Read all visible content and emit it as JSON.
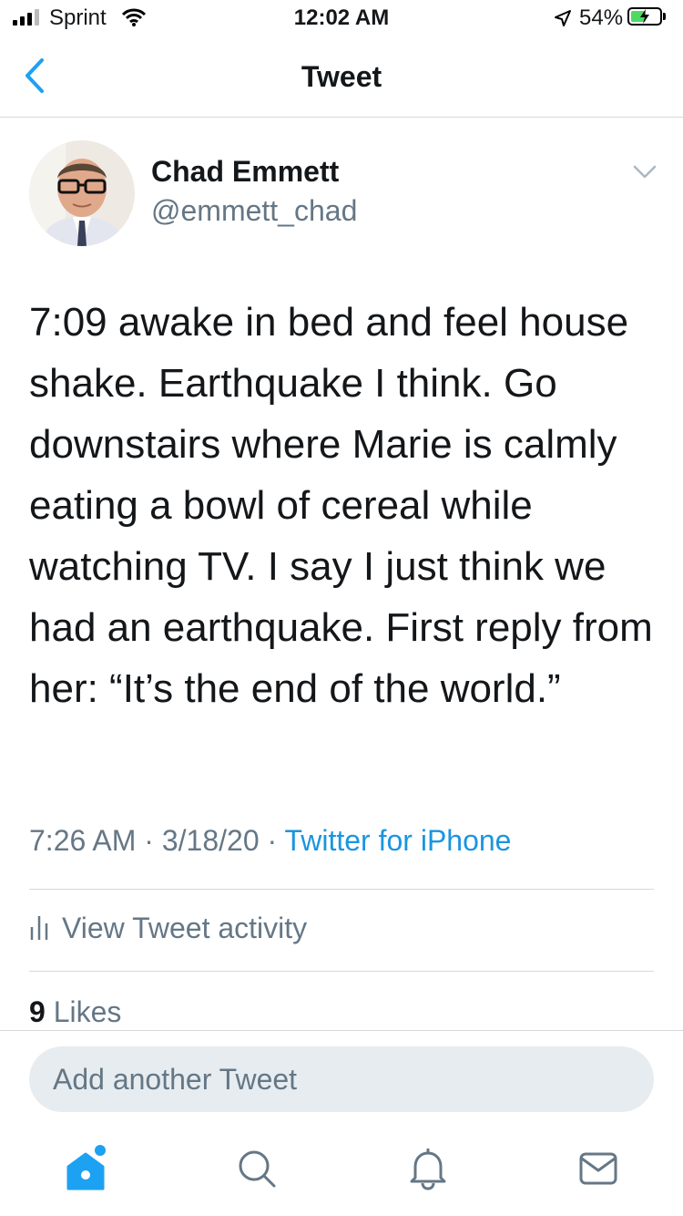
{
  "status_bar": {
    "carrier": "Sprint",
    "time": "12:02 AM",
    "battery_percent": "54%",
    "battery_level": 0.54
  },
  "nav": {
    "title": "Tweet",
    "back_icon": "chevron-left-icon"
  },
  "tweet": {
    "author_name": "Chad Emmett",
    "handle": "@emmett_chad",
    "text": "7:09 awake in bed and feel house shake. Earthquake I think. Go downstairs where Marie is calmly eating a bowl of cereal while watching TV. I  say I just think we had an earthquake. First reply from her: “It’s the end of the world.”",
    "time": "7:26 AM",
    "date": "3/18/20",
    "separator": " · ",
    "source": "Twitter for iPhone",
    "activity_label": "View Tweet activity",
    "likes_count": "9",
    "likes_label": "Likes"
  },
  "composer": {
    "placeholder": "Add another Tweet"
  },
  "tab_bar": {
    "items": [
      "home-icon",
      "search-icon",
      "notifications-icon",
      "messages-icon"
    ],
    "active_color": "#1da1f2"
  },
  "colors": {
    "accent": "#1b95e0",
    "secondary_text": "#657786",
    "divider": "#d6d9db"
  }
}
